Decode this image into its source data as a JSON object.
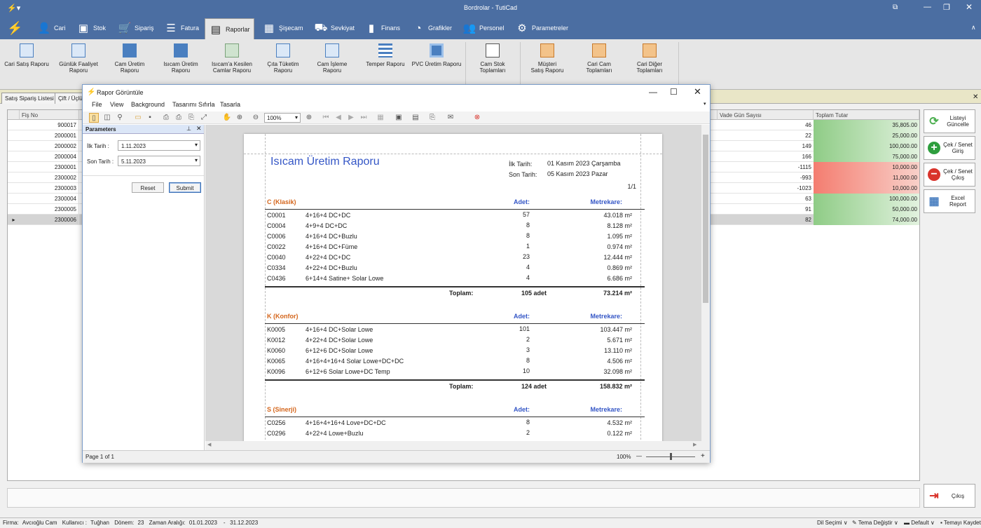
{
  "app": {
    "title": "Bordrolar - TutiCad"
  },
  "topmenu": [
    {
      "label": "Cari",
      "icon": "person-icon"
    },
    {
      "label": "Stok",
      "icon": "box-icon"
    },
    {
      "label": "Sipariş",
      "icon": "cart-icon"
    },
    {
      "label": "Fatura",
      "icon": "invoice-icon"
    },
    {
      "label": "Raporlar",
      "icon": "report-icon"
    },
    {
      "label": "Şişecam",
      "icon": "grid-icon"
    },
    {
      "label": "Sevkiyat",
      "icon": "truck-icon"
    },
    {
      "label": "Finans",
      "icon": "bars-icon"
    },
    {
      "label": "Grafikler",
      "icon": "pie-icon"
    },
    {
      "label": "Personel",
      "icon": "people-icon"
    },
    {
      "label": "Parametreler",
      "icon": "gear-icon"
    }
  ],
  "ribbon": [
    [
      "Cari Satış Raporu",
      ""
    ],
    [
      "Günlük Faaliyet",
      "Raporu"
    ],
    [
      "Cam Üretim",
      "Raporu"
    ],
    [
      "Isıcam Üretim",
      "Raporu"
    ],
    [
      "Isıcam'a Kesilen",
      "Camlar Raporu"
    ],
    [
      "Çıta Tüketim",
      "Raporu"
    ],
    [
      "Cam İşleme",
      "Raporu"
    ],
    [
      "Temper Raporu",
      ""
    ],
    [
      "PVC Üretim Raporu",
      ""
    ],
    [
      "Cam Stok",
      "Toplamları"
    ],
    [
      "Müşteri",
      "Satış Raporu"
    ],
    [
      "Cari Cam",
      "Toplamları"
    ],
    [
      "Cari Diğer",
      "Toplamları"
    ]
  ],
  "tabs": [
    "Satış Sipariş Listesi",
    "Çift / Üçlü"
  ],
  "grid": {
    "headers": {
      "fis_no": "Fiş No",
      "vade": "Vade Gün Sayısı",
      "toplam": "Toplam Tutar"
    },
    "rows": [
      {
        "fis": "900017",
        "vade": "46",
        "tutar": "35,805.00",
        "neg": false
      },
      {
        "fis": "2000001",
        "vade": "22",
        "tutar": "25,000.00",
        "neg": false
      },
      {
        "fis": "2000002",
        "vade": "149",
        "tutar": "100,000.00",
        "neg": false
      },
      {
        "fis": "2000004",
        "vade": "166",
        "tutar": "75,000.00",
        "neg": false
      },
      {
        "fis": "2300001",
        "vade": "-1115",
        "tutar": "10,000.00",
        "neg": true
      },
      {
        "fis": "2300002",
        "vade": "-993",
        "tutar": "11,000.00",
        "neg": true
      },
      {
        "fis": "2300003",
        "vade": "-1023",
        "tutar": "10,000.00",
        "neg": true
      },
      {
        "fis": "2300004",
        "vade": "63",
        "tutar": "100,000.00",
        "neg": false
      },
      {
        "fis": "2300005",
        "vade": "91",
        "tutar": "50,000.00",
        "neg": false
      },
      {
        "fis": "2300006",
        "vade": "82",
        "tutar": "74,000.00",
        "neg": false
      }
    ]
  },
  "sidebar": {
    "refresh": [
      "Listeyi",
      "Güncelle"
    ],
    "cek_giris": [
      "Çek / Senet",
      "Giriş"
    ],
    "cek_cikis": [
      "Çek / Senet",
      "Çıkış"
    ],
    "excel": [
      "Excel",
      "Report"
    ],
    "exit": "Çıkış"
  },
  "status": {
    "firma": "Firma:",
    "firma_val": "Avcıoğlu Cam",
    "kullanici": "Kullanıcı :",
    "kullanici_val": "Tuğhan",
    "donem": "Dönem:",
    "donem_val": "23",
    "aralik": "Zaman Aralığı:",
    "aralik_val": "01.01.2023    -   31.12.2023",
    "dil": "Dil Seçimi",
    "tema": "Tema Değiştir",
    "default": "Default",
    "kaydet": "Temayı Kaydet"
  },
  "viewer": {
    "title": "Rapor Görüntüle",
    "menu": [
      "File",
      "View",
      "Background",
      "Tasarımı Sıfırla",
      "Tasarla"
    ],
    "zoom": "100%",
    "params": {
      "title": "Parameters",
      "ilk_label": "İlk Tarih :",
      "ilk_val": "1.11.2023",
      "son_label": "Son Tarih :",
      "son_val": "5.11.2023",
      "reset": "Reset",
      "submit": "Submit"
    },
    "status": {
      "page": "Page 1 of 1",
      "zoom": "100%"
    }
  },
  "report": {
    "title": "Isıcam Üretim Raporu",
    "ilk_label": "İlk Tarih:",
    "ilk_val": "01 Kasım 2023 Çarşamba",
    "son_label": "Son Tarih:",
    "son_val": "05 Kasım 2023 Pazar",
    "page": "1/1",
    "adet_h": "Adet:",
    "metre_h": "Metrekare:",
    "toplam_label": "Toplam:",
    "groups": [
      {
        "name": "C (Klasik)",
        "rows": [
          [
            "C0001",
            "4+16+4 DC+DC",
            "57",
            "43.018 m²"
          ],
          [
            "C0004",
            "4+9+4 DC+DC",
            "8",
            "8.128 m²"
          ],
          [
            "C0006",
            "4+16+4 DC+Buzlu",
            "8",
            "1.095 m²"
          ],
          [
            "C0022",
            "4+16+4 DC+Füme",
            "1",
            "0.974 m²"
          ],
          [
            "C0040",
            "4+22+4 DC+DC",
            "23",
            "12.444 m²"
          ],
          [
            "C0334",
            "4+22+4 DC+Buzlu",
            "4",
            "0.869 m²"
          ],
          [
            "C0436",
            "6+14+4 Satine+ Solar Lowe",
            "4",
            "6.686 m²"
          ]
        ],
        "toplam_adet": "105 adet",
        "toplam_m2": "73.214 m²"
      },
      {
        "name": "K (Konfor)",
        "rows": [
          [
            "K0005",
            "4+16+4 DC+Solar Lowe",
            "101",
            "103.447 m²"
          ],
          [
            "K0012",
            "4+22+4 DC+Solar Lowe",
            "2",
            "5.671 m²"
          ],
          [
            "K0060",
            "6+12+6 DC+Solar Lowe",
            "3",
            "13.110 m²"
          ],
          [
            "K0065",
            "4+16+4+16+4 Solar Lowe+DC+DC",
            "8",
            "4.506 m²"
          ],
          [
            "K0096",
            "6+12+6 Solar Lowe+DC Temp",
            "10",
            "32.098 m²"
          ]
        ],
        "toplam_adet": "124 adet",
        "toplam_m2": "158.832 m²"
      },
      {
        "name": "S (Sinerji)",
        "rows": [
          [
            "C0256",
            "4+16+4+16+4 Love+DC+DC",
            "8",
            "4.532 m²"
          ],
          [
            "C0296",
            "4+22+4 Lowe+Buzlu",
            "2",
            "0.122 m²"
          ]
        ]
      }
    ]
  },
  "colors": {
    "accent": "#4b6ea2",
    "green_cell": "#a9d6a0",
    "red_cell": "#f49a8f",
    "report_blue": "#3456c6",
    "report_orange": "#d4651b"
  }
}
